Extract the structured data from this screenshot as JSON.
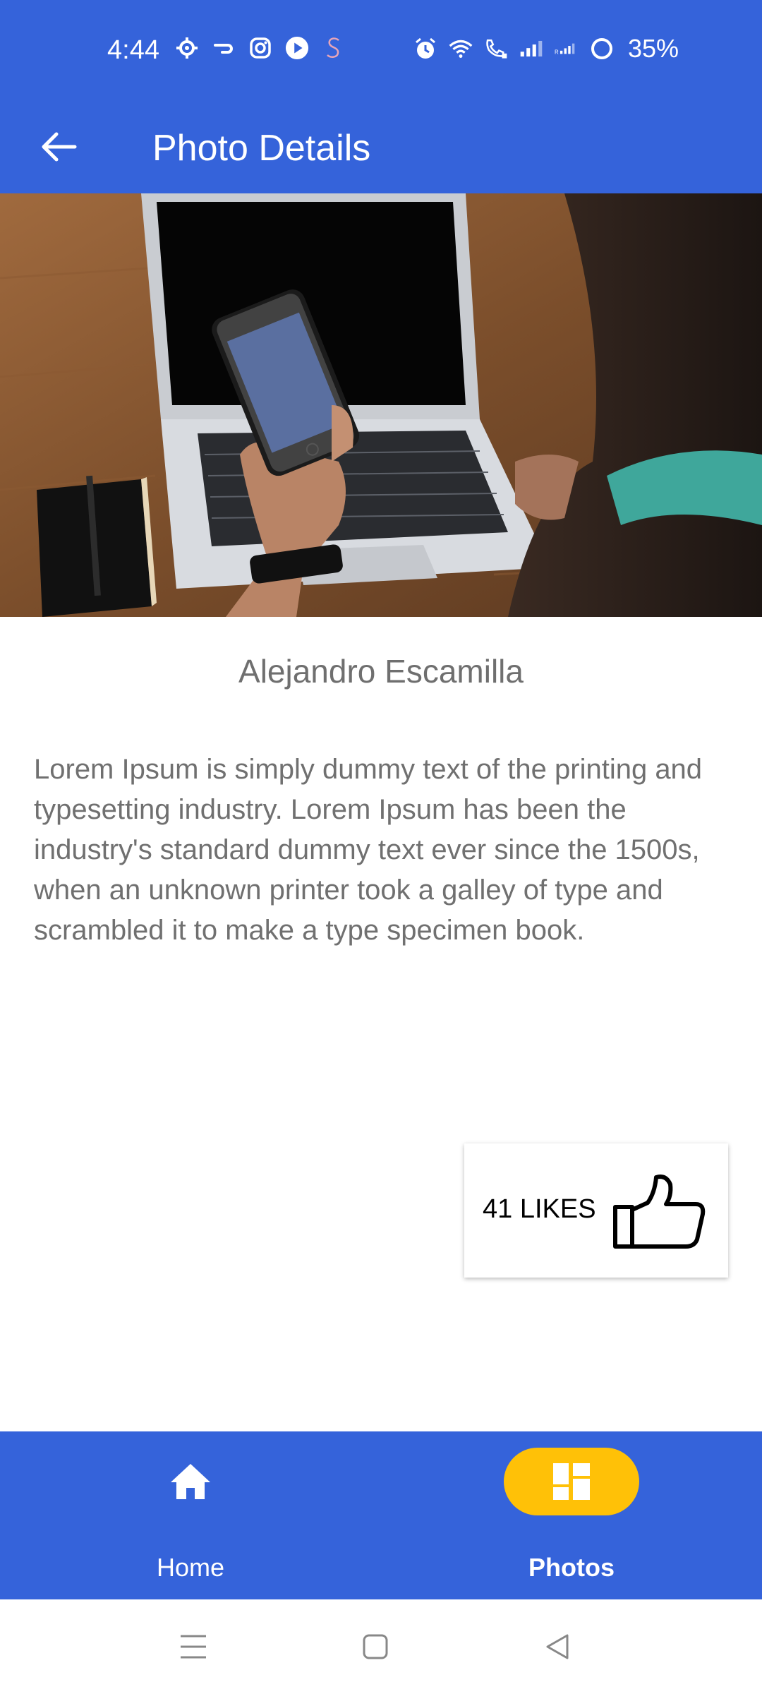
{
  "status_bar": {
    "time": "4:44",
    "battery": "35%",
    "left_icons": [
      "settings-icon",
      "link-icon",
      "instagram-icon",
      "play-icon",
      "s-icon"
    ],
    "right_icons": [
      "alarm-icon",
      "wifi-icon",
      "wifi-call-icon",
      "signal-icon",
      "roaming-signal-icon",
      "battery-ring-icon"
    ]
  },
  "app_bar": {
    "title": "Photo Details",
    "back_icon": "arrow-back-icon",
    "background": "#3563DA"
  },
  "photo": {
    "subject": "hand holding smartphone in front of laptop on wooden desk"
  },
  "details": {
    "author": "Alejandro Escamilla",
    "description": "Lorem Ipsum is simply dummy text of the printing and typesetting industry. Lorem Ipsum has been the industry's standard dummy text ever since the 1500s, when an unknown printer took a galley of type and scrambled it to make a type specimen book."
  },
  "likes": {
    "label": "41 LIKES",
    "icon": "thumbs-up-icon"
  },
  "bottom_nav": {
    "items": [
      {
        "label": "Home",
        "icon": "home-icon",
        "active": false
      },
      {
        "label": "Photos",
        "icon": "dashboard-icon",
        "active": true
      }
    ],
    "active_color": "#FFC107"
  },
  "system_nav": {
    "buttons": [
      "menu-icon",
      "home-square-icon",
      "back-triangle-icon"
    ]
  }
}
